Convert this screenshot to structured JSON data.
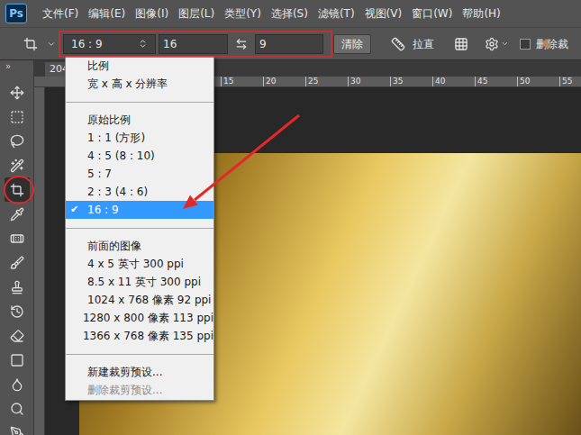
{
  "app": {
    "logo": "Ps"
  },
  "menubar": {
    "items": [
      "文件(F)",
      "编辑(E)",
      "图像(I)",
      "图层(L)",
      "类型(Y)",
      "选择(S)",
      "滤镜(T)",
      "视图(V)",
      "窗口(W)",
      "帮助(H)"
    ]
  },
  "options_bar": {
    "ratio_preset": "16 : 9",
    "width": "16",
    "height": "9",
    "clear_button": "清除",
    "straighten_label": "拉直",
    "delete_cropped": {
      "label": "删除裁",
      "checked": false
    }
  },
  "toolbar": {
    "collapse": "»",
    "tools": [
      {
        "selected": false
      },
      {
        "selected": false
      },
      {
        "selected": false
      },
      {
        "selected": false
      },
      {
        "selected": true
      },
      {
        "selected": false
      },
      {
        "selected": false
      },
      {
        "selected": false
      },
      {
        "selected": false
      },
      {
        "selected": false
      },
      {
        "selected": false
      },
      {
        "selected": false
      },
      {
        "selected": false
      },
      {
        "selected": false
      },
      {
        "selected": false
      }
    ]
  },
  "document": {
    "tab": "204",
    "ruler_labels": [
      "15",
      "20",
      "25",
      "30",
      "35",
      "40",
      "45",
      "50",
      "55"
    ]
  },
  "ratio_menu": {
    "check_mark": "✔",
    "items": [
      {
        "kind": "item",
        "label": "比例",
        "selected": false,
        "disabled": false,
        "checked": false
      },
      {
        "kind": "item",
        "label": "宽 x 高 x 分辨率",
        "selected": false,
        "disabled": false,
        "checked": false
      },
      {
        "kind": "separator",
        "label": "",
        "selected": false,
        "disabled": false,
        "checked": false
      },
      {
        "kind": "item",
        "label": "原始比例",
        "selected": false,
        "disabled": false,
        "checked": false
      },
      {
        "kind": "item",
        "label": "1 : 1 (方形)",
        "selected": false,
        "disabled": false,
        "checked": false
      },
      {
        "kind": "item",
        "label": "4 : 5 (8 : 10)",
        "selected": false,
        "disabled": false,
        "checked": false
      },
      {
        "kind": "item",
        "label": "5 : 7",
        "selected": false,
        "disabled": false,
        "checked": false
      },
      {
        "kind": "item",
        "label": "2 : 3 (4 : 6)",
        "selected": false,
        "disabled": false,
        "checked": false
      },
      {
        "kind": "item",
        "label": "16 : 9",
        "selected": true,
        "disabled": false,
        "checked": true
      },
      {
        "kind": "separator",
        "label": "",
        "selected": false,
        "disabled": false,
        "checked": false
      },
      {
        "kind": "item",
        "label": "前面的图像",
        "selected": false,
        "disabled": false,
        "checked": false
      },
      {
        "kind": "item",
        "label": "4 x 5 英寸 300 ppi",
        "selected": false,
        "disabled": false,
        "checked": false
      },
      {
        "kind": "item",
        "label": "8.5 x 11 英寸 300 ppi",
        "selected": false,
        "disabled": false,
        "checked": false
      },
      {
        "kind": "item",
        "label": "1024 x 768 像素 92 ppi",
        "selected": false,
        "disabled": false,
        "checked": false
      },
      {
        "kind": "item",
        "label": "1280 x 800 像素 113 ppi",
        "selected": false,
        "disabled": false,
        "checked": false
      },
      {
        "kind": "item",
        "label": "1366 x 768 像素 135 ppi",
        "selected": false,
        "disabled": false,
        "checked": false
      },
      {
        "kind": "separator",
        "label": "",
        "selected": false,
        "disabled": false,
        "checked": false
      },
      {
        "kind": "item",
        "label": "新建裁剪预设...",
        "selected": false,
        "disabled": false,
        "checked": false
      },
      {
        "kind": "item",
        "label": "删除裁剪预设...",
        "selected": false,
        "disabled": true,
        "checked": false
      }
    ]
  }
}
